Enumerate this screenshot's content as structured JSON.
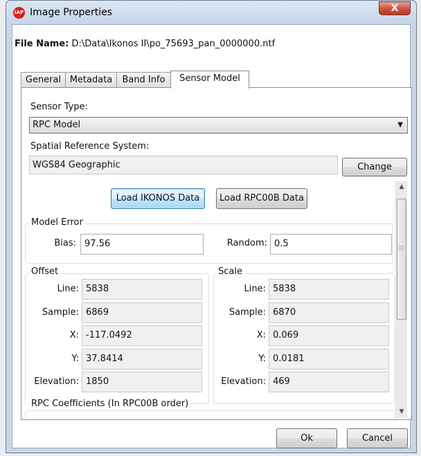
{
  "window": {
    "title": "Image Properties",
    "close_symbol": "X"
  },
  "file": {
    "label": "File Name:",
    "value": "D:\\Data\\Ikonos II\\po_75693_pan_0000000.ntf"
  },
  "tabs": [
    {
      "label": "General"
    },
    {
      "label": "Metadata"
    },
    {
      "label": "Band Info"
    },
    {
      "label": "Sensor Model"
    }
  ],
  "sensor": {
    "type_label": "Sensor Type:",
    "type_value": "RPC Model",
    "srs_label": "Spatial Reference System:",
    "srs_value": "WGS84 Geographic",
    "change_label": "Change"
  },
  "load": {
    "ikonos_label": "Load IKONOS Data",
    "rpc00b_label": "Load RPC00B Data"
  },
  "model_error": {
    "title": "Model Error",
    "bias_label": "Bias:",
    "bias_value": "97.56",
    "random_label": "Random:",
    "random_value": "0.5"
  },
  "offset": {
    "title": "Offset",
    "line_label": "Line:",
    "line_value": "5838",
    "sample_label": "Sample:",
    "sample_value": "6869",
    "x_label": "X:",
    "x_value": "-117.0492",
    "y_label": "Y:",
    "y_value": "37.8414",
    "elev_label": "Elevation:",
    "elev_value": "1850"
  },
  "scale": {
    "title": "Scale",
    "line_label": "Line:",
    "line_value": "5838",
    "sample_label": "Sample:",
    "sample_value": "6870",
    "x_label": "X:",
    "x_value": "0.069",
    "y_label": "Y:",
    "y_value": "0.0181",
    "elev_label": "Elevation:",
    "elev_value": "469"
  },
  "rpc": {
    "title": "RPC Coefficients (In RPC00B order)"
  },
  "footer": {
    "ok_label": "Ok",
    "cancel_label": "Cancel"
  },
  "colors": {
    "close_button": "#c9523f",
    "focus_border": "#3c7fb1",
    "app_icon": "#d8231c"
  },
  "icons": {
    "app": "app-logo-icon",
    "close": "close-icon",
    "combo_arrow": "chevron-down-icon",
    "scroll_up": "scroll-up-icon",
    "scroll_down": "scroll-down-icon"
  }
}
